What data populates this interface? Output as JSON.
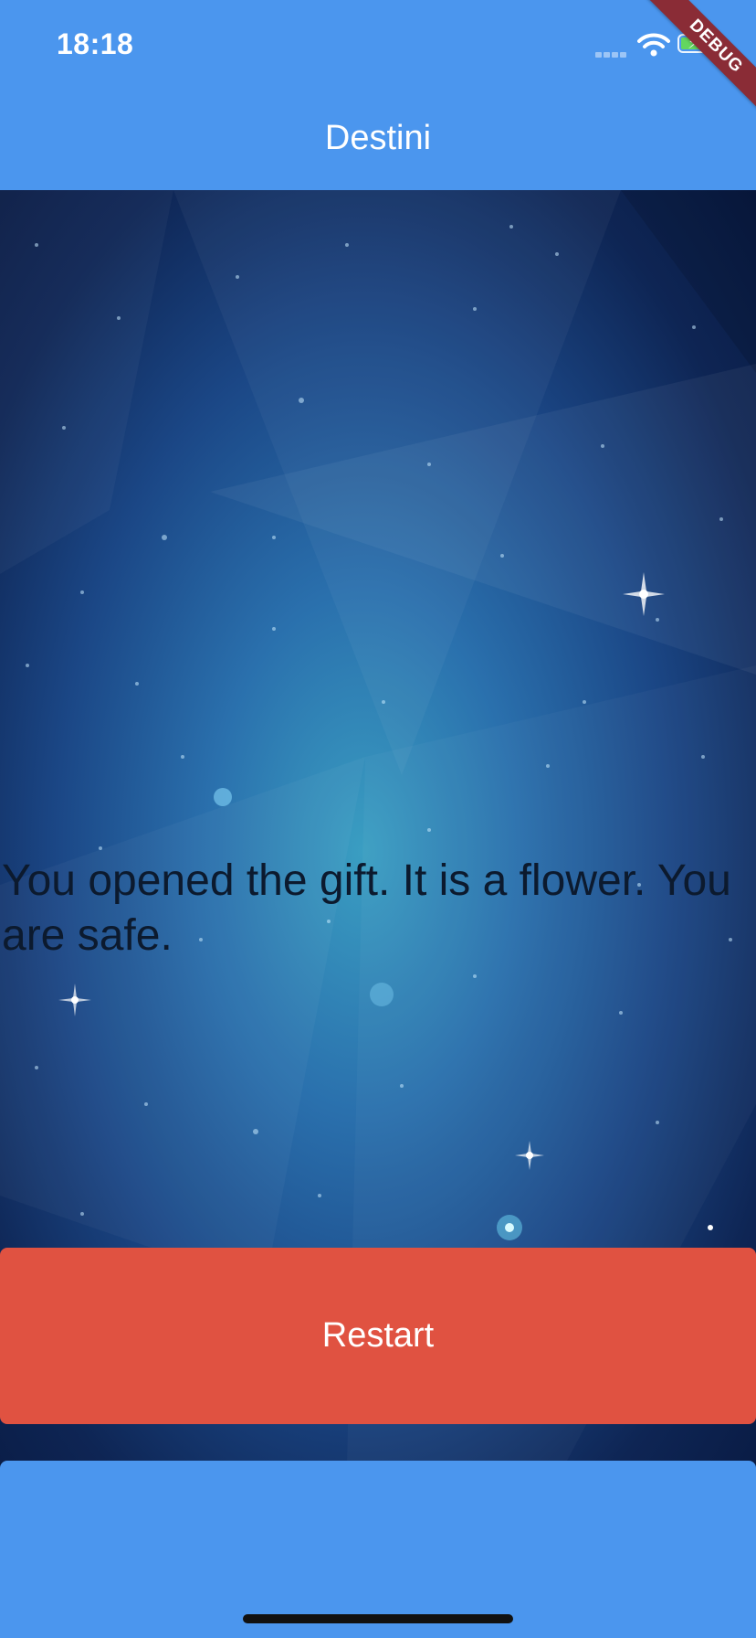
{
  "status_bar": {
    "time": "18:18",
    "icons": [
      "signal-icon",
      "wifi-icon",
      "battery-charging-icon"
    ]
  },
  "debug_banner": {
    "label": "DEBUG"
  },
  "app_bar": {
    "title": "Destini"
  },
  "story": {
    "text": "You opened the gift. It is a flower. You are safe."
  },
  "restart_button": {
    "label": "Restart"
  },
  "colors": {
    "app_bar": "#4b96ee",
    "restart_button": "#e05241",
    "story_text": "#0c1a2e",
    "debug_banner": "#8a2c36"
  }
}
